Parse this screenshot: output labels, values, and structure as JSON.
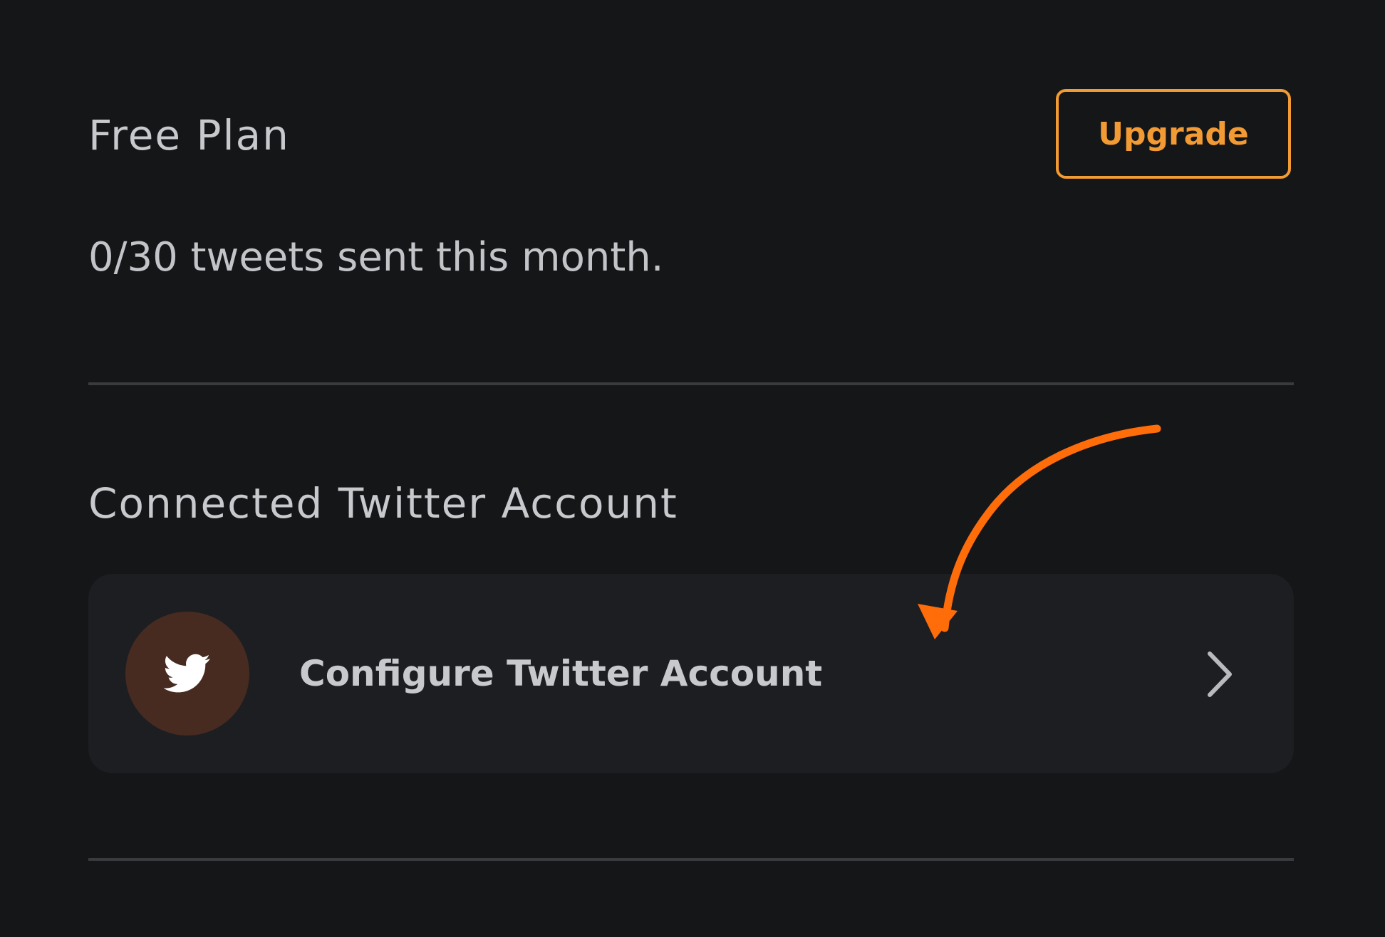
{
  "plan": {
    "title": "Free Plan",
    "upgrade_label": "Upgrade",
    "usage_text": "0/30 tweets sent this month."
  },
  "twitter": {
    "heading": "Connected Twitter Account",
    "configure_label": "Configure Twitter Account",
    "icon": "twitter-bird-icon",
    "chevron_icon": "chevron-right-icon"
  },
  "colors": {
    "background": "#151618",
    "accent": "#f29a33",
    "card": "#1d1e22",
    "avatar": "#472b21",
    "annotation_arrow": "#ff6d0a"
  }
}
